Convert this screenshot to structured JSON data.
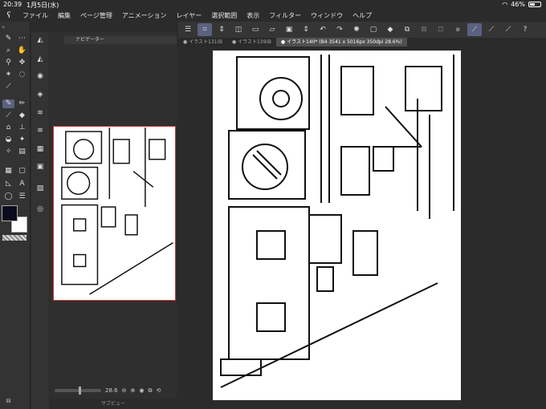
{
  "status": {
    "time": "20:39",
    "date": "1月5日(水)",
    "battery": "46%",
    "battery_level": 0.46
  },
  "menu": {
    "items": [
      "ファイル",
      "編集",
      "ページ管理",
      "アニメーション",
      "レイヤー",
      "選択範囲",
      "表示",
      "フィルター",
      "ウィンドウ",
      "ヘルプ"
    ]
  },
  "navigator": {
    "title": "ナビゲーター",
    "zoom": "28.6",
    "subview_label": "サブビュー"
  },
  "tabs": [
    {
      "label": "イラスト131(B"
    },
    {
      "label": "イラスト139(B"
    },
    {
      "label": "イラスト140* (B4 3541 x 5016px 350dpi 28.6%)"
    }
  ],
  "colors": {
    "main": "#0b0b1e",
    "sub": "#ffffff",
    "accent": "#5a6280",
    "frame": "#cc3333"
  }
}
